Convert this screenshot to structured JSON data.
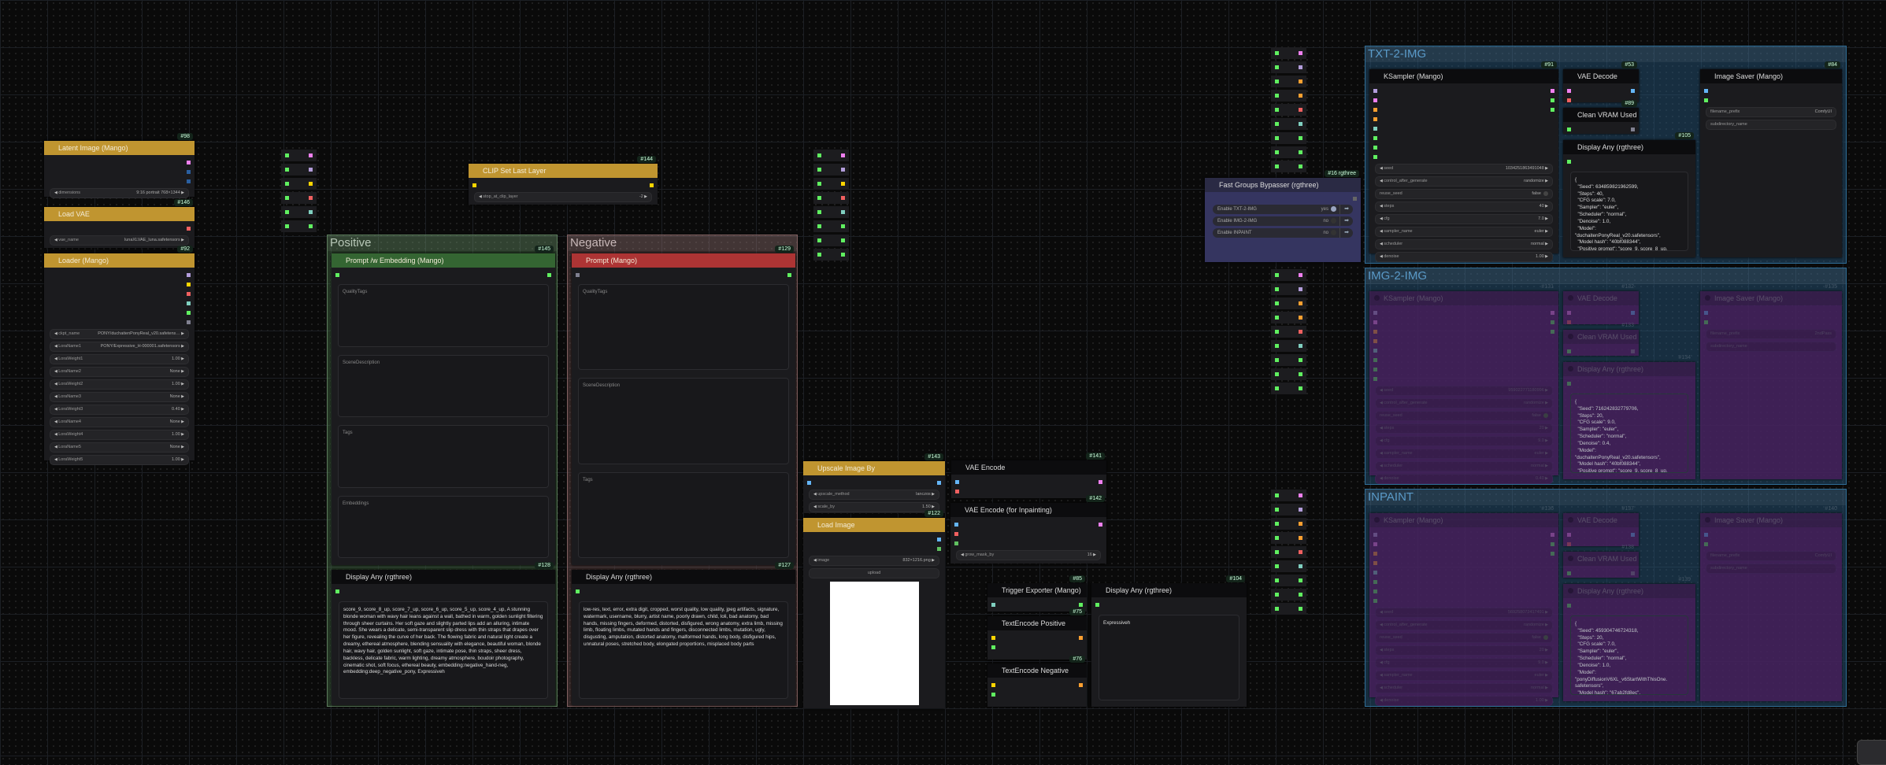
{
  "colors": {
    "header_gold": "#c09530",
    "header_green": "#346532",
    "header_red": "#ad3434",
    "header_dark": "#0c0c0e",
    "slot_pink": "#f080f0",
    "slot_purple": "#b39ddb",
    "slot_yellow": "#ffd500",
    "slot_red": "#f06060",
    "slot_teal": "#80d0c0",
    "slot_green": "#60f060",
    "slot_blue": "#64b5f6",
    "slot_darkblue": "#2a5fa0",
    "slot_orange": "#ffa030",
    "slot_gray": "#808090"
  },
  "groups": {
    "positive": {
      "title": "Positive",
      "bg": "rgba(90,140,90,0.35)",
      "border": "#5c7c5c",
      "fg": "#b8c8b8"
    },
    "negative": {
      "title": "Negative",
      "bg": "rgba(140,100,100,0.35)",
      "border": "#806060",
      "fg": "#c8b8b8"
    },
    "txt2img": {
      "title": "TXT-2-IMG",
      "bg": "rgba(40,90,130,0.45)",
      "border": "#2f6d96",
      "fg": "#5a9ac8"
    },
    "img2img": {
      "title": "IMG-2-IMG",
      "bg": "rgba(40,90,130,0.45)",
      "border": "#2f6d96",
      "fg": "#5a9ac8"
    },
    "inpaint": {
      "title": "INPAINT",
      "bg": "rgba(40,90,130,0.45)",
      "border": "#2f6d96",
      "fg": "#5a9ac8"
    }
  },
  "nodes": {
    "latent_image": {
      "id": "#98",
      "title": "Latent Image (Mango)",
      "header": "#c09530",
      "inputs": [],
      "outputs": [
        "#f080f0",
        "#2a5fa0",
        "#2a5fa0"
      ],
      "widgets": [
        {
          "label": "dimensions",
          "value": "9:16 portrait 768×1344",
          "type": "combo"
        }
      ]
    },
    "load_vae": {
      "id": "#146",
      "title": "Load VAE",
      "header": "#c09530",
      "inputs": [],
      "outputs": [
        "#f06060"
      ],
      "widgets": [
        {
          "label": "vae_name",
          "value": "lunaXLVAE_luna.safetensors",
          "type": "combo"
        }
      ]
    },
    "loader": {
      "id": "#92",
      "title": "Loader (Mango)",
      "header": "#c09530",
      "inputs": [],
      "outputs": [
        "#b39ddb",
        "#ffd500",
        "#f06060",
        "#80d0c0",
        "#60f060",
        "#808090"
      ],
      "widgets": [
        {
          "label": "ckpt_name",
          "value": "PONY/duchaitenPonyReal_v20.safetens…",
          "type": "combo"
        },
        {
          "label": "LoraName1",
          "value": "PONY/Expressive_H-000001.safetensors",
          "type": "combo"
        },
        {
          "label": "LoraWeight1",
          "value": "1.00",
          "type": "combo"
        },
        {
          "label": "LoraName2",
          "value": "None",
          "type": "combo"
        },
        {
          "label": "LoraWeight2",
          "value": "1.00",
          "type": "combo"
        },
        {
          "label": "LoraName3",
          "value": "None",
          "type": "combo"
        },
        {
          "label": "LoraWeight3",
          "value": "0.40",
          "type": "combo"
        },
        {
          "label": "LoraName4",
          "value": "None",
          "type": "combo"
        },
        {
          "label": "LoraWeight4",
          "value": "1.00",
          "type": "combo"
        },
        {
          "label": "LoraName5",
          "value": "None",
          "type": "combo"
        },
        {
          "label": "LoraWeight5",
          "value": "1.00",
          "type": "combo"
        }
      ]
    },
    "clip_last_layer": {
      "id": "#144",
      "title": "CLIP Set Last Layer",
      "header": "#c09530",
      "inputs": [
        "#ffd500"
      ],
      "outputs": [
        "#ffd500"
      ],
      "widgets": [
        {
          "label": "stop_at_clip_layer",
          "value": "-2",
          "type": "combo"
        }
      ]
    },
    "prompt_pos": {
      "id": "#145",
      "title": "Prompt /w Embedding (Mango)",
      "header": "#346532",
      "inputs": [
        "#60f060"
      ],
      "outputs": [
        "#60f060"
      ],
      "textareas": [
        "QualityTags",
        "SceneDescription",
        "Tags",
        "Embeddings"
      ]
    },
    "display_pos": {
      "id": "#128",
      "title": "Display Any (rgthree)",
      "header": "#0c0c0e",
      "inputs": [
        "#60f060"
      ],
      "outputs": [],
      "display": "score_9, score_8_up, score_7_up, score_6_up, score_5_up, score_4_up, A stunning blonde woman with wavy hair leans against a wall, bathed in warm, golden sunlight filtering through sheer curtains. Her soft gaze and slightly parted lips add an alluring, intimate mood. She wears a delicate, semi-transparent slip dress with thin straps that drapes over her figure, revealing the curve of her back. The flowing fabric and natural light create a dreamy, ethereal atmosphere, blending sensuality with elegance, beautiful woman, blonde hair, wavy hair, golden sunlight, soft gaze, intimate pose, thin straps, sheer dress, backless, delicate fabric, warm lighting, dreamy atmosphere, boudoir photography, cinematic shot, soft focus, ethereal beauty, embedding:negative_hand-neg, embedding:deep_negative_pony, Expressiveh"
    },
    "prompt_neg": {
      "id": "#129",
      "title": "Prompt (Mango)",
      "header": "#ad3434",
      "inputs": [
        "#808090"
      ],
      "outputs": [
        "#60f060"
      ],
      "textareas": [
        "QualityTags",
        "SceneDescription",
        "Tags"
      ]
    },
    "display_neg": {
      "id": "#127",
      "title": "Display Any (rgthree)",
      "header": "#0c0c0e",
      "inputs": [
        "#60f060"
      ],
      "outputs": [],
      "display": "low-res, text, error, extra digit, cropped, worst quality, low quality, jpeg artifacts, signature, watermark, username, blurry, artist name, poorly drawn, child, loli, bad anatomy, bad hands, missing fingers, deformed, distorted, disfigured, wrong anatomy, extra limb, missing limb, floating limbs, mutated hands and fingers, disconnected limbs, mutation, ugly, disgusting, amputation, distorted anatomy, malformed hands, long body, disfigured hips, unnatural poses, stretched body, elongated proportions, misplaced body parts"
    },
    "upscale": {
      "id": "#143",
      "title": "Upscale Image By",
      "header": "#c09530",
      "inputs": [
        "#64b5f6"
      ],
      "outputs": [
        "#64b5f6"
      ],
      "widgets": [
        {
          "label": "upscale_method",
          "value": "lanczos",
          "type": "combo"
        },
        {
          "label": "scale_by",
          "value": "1.50",
          "type": "combo"
        }
      ]
    },
    "load_image": {
      "id": "#122",
      "title": "Load Image",
      "header": "#c09530",
      "inputs": [],
      "outputs": [
        "#64b5f6",
        "#60c060"
      ],
      "widgets": [
        {
          "label": "image",
          "value": "832×1216.png",
          "type": "combo"
        },
        {
          "label": "upload",
          "value": "",
          "type": "button"
        }
      ],
      "preview": true
    },
    "vae_encode": {
      "id": "#141",
      "title": "VAE Encode",
      "header": "#0c0c0e",
      "inputs": [
        "#64b5f6",
        "#f06060"
      ],
      "outputs": [
        "#f080f0"
      ]
    },
    "vae_encode_inpaint": {
      "id": "#142",
      "title": "VAE Encode (for Inpainting)",
      "header": "#0c0c0e",
      "inputs": [
        "#64b5f6",
        "#f06060",
        "#60c060"
      ],
      "outputs": [
        "#f080f0"
      ],
      "widgets": [
        {
          "label": "grow_mask_by",
          "value": "16",
          "type": "combo"
        }
      ]
    },
    "trigger_exporter": {
      "id": "#85",
      "title": "Trigger Exporter (Mango)",
      "header": "#0c0c0e",
      "inputs": [
        "#80d0c0"
      ],
      "outputs": [
        "#60f060"
      ]
    },
    "textencode_pos": {
      "id": "#75",
      "title": "TextEncode Positive",
      "header": "#0c0c0e",
      "inputs": [
        "#ffd500",
        "#60f060"
      ],
      "outputs": [
        "#ffa030"
      ]
    },
    "textencode_neg": {
      "id": "#76",
      "title": "TextEncode Negative",
      "header": "#0c0c0e",
      "inputs": [
        "#ffd500",
        "#60f060"
      ],
      "outputs": [
        "#ffa030"
      ]
    },
    "display_trigger": {
      "id": "#104",
      "title": "Display Any (rgthree)",
      "header": "#0c0c0e",
      "inputs": [
        "#60f060"
      ],
      "outputs": [],
      "display": "Expressiveh"
    },
    "t2i_ksampler": {
      "id": "#91",
      "title": "KSampler (Mango)",
      "header": "#0c0c0e",
      "inputs": [
        "#b39ddb",
        "#f080f0",
        "#ffa030",
        "#ffa030",
        "#80d0c0",
        "#60f060",
        "#60f060",
        "#60f060"
      ],
      "outputs": [
        "#f080f0",
        "#60f060",
        "#60f060"
      ],
      "widgets": [
        {
          "label": "seed",
          "value": "1034251863491048",
          "type": "combo"
        },
        {
          "label": "control_after_generate",
          "value": "randomize",
          "type": "combo"
        },
        {
          "label": "reuse_seed",
          "value": "false",
          "type": "toggle"
        },
        {
          "label": "steps",
          "value": "40",
          "type": "combo"
        },
        {
          "label": "cfg",
          "value": "7.0",
          "type": "combo"
        },
        {
          "label": "sampler_name",
          "value": "euler",
          "type": "combo"
        },
        {
          "label": "scheduler",
          "value": "normal",
          "type": "combo"
        },
        {
          "label": "denoise",
          "value": "1.00",
          "type": "combo"
        }
      ]
    },
    "t2i_vae_decode": {
      "id": "#53",
      "title": "VAE Decode",
      "header": "#0c0c0e",
      "inputs": [
        "#f080f0",
        "#f06060"
      ],
      "outputs": [
        "#64b5f6"
      ]
    },
    "t2i_clean_vram": {
      "id": "#89",
      "title": "Clean VRAM Used",
      "header": "#0c0c0e",
      "inputs": [
        "#60f060"
      ],
      "outputs": [
        "#808090"
      ]
    },
    "t2i_display": {
      "id": "#105",
      "title": "Display Any (rgthree)",
      "header": "#0c0c0e",
      "inputs": [
        "#60f060"
      ],
      "outputs": [],
      "display": "{\n  \"Seed\": 634859821962599,\n  \"Steps\": 40,\n  \"CFG scale\": 7.0,\n  \"Sampler\": \"euler\",\n  \"Scheduler\": \"normal\",\n  \"Denoise\": 1.0,\n  \"Model\":\n\"duchaitenPonyReal_v20.safetensors\",\n  \"Model hash\": \"40bf088344\",\n  \"Positive prompt\": \"score_9, score_8_up,"
    },
    "t2i_image_saver": {
      "id": "#84",
      "title": "Image Saver (Mango)",
      "header": "#0c0c0e",
      "inputs": [
        "#64b5f6",
        "#60f060"
      ],
      "outputs": [],
      "widgets": [
        {
          "label": "filename_prefix",
          "value": "ComfyUI",
          "type": "text"
        },
        {
          "label": "subdirectory_name",
          "value": "",
          "type": "text"
        }
      ]
    },
    "i2i_ksampler": {
      "id": "#131",
      "title": "KSampler (Mango)",
      "header": "#0c0c0e",
      "bypassed": true,
      "inputs": [
        "#b39ddb",
        "#f080f0",
        "#ffa030",
        "#ffa030",
        "#80d0c0",
        "#60f060",
        "#60f060",
        "#60f060"
      ],
      "outputs": [
        "#f080f0",
        "#60f060",
        "#60f060"
      ],
      "widgets": [
        {
          "label": "seed",
          "value": "959022771180996",
          "type": "combo"
        },
        {
          "label": "control_after_generate",
          "value": "randomize",
          "type": "combo"
        },
        {
          "label": "reuse_seed",
          "value": "false",
          "type": "toggle"
        },
        {
          "label": "steps",
          "value": "20",
          "type": "combo"
        },
        {
          "label": "cfg",
          "value": "9.0",
          "type": "combo"
        },
        {
          "label": "sampler_name",
          "value": "euler",
          "type": "combo"
        },
        {
          "label": "scheduler",
          "value": "normal",
          "type": "combo"
        },
        {
          "label": "denoise",
          "value": "0.40",
          "type": "combo"
        }
      ]
    },
    "i2i_vae_decode": {
      "id": "#132",
      "title": "VAE Decode",
      "header": "#0c0c0e",
      "bypassed": true,
      "inputs": [
        "#f080f0",
        "#f06060"
      ],
      "outputs": [
        "#64b5f6"
      ]
    },
    "i2i_clean_vram": {
      "id": "#133",
      "title": "Clean VRAM Used",
      "header": "#0c0c0e",
      "bypassed": true,
      "inputs": [
        "#60f060"
      ],
      "outputs": [
        "#808090"
      ]
    },
    "i2i_display": {
      "id": "#134",
      "title": "Display Any (rgthree)",
      "header": "#0c0c0e",
      "bypassed": true,
      "inputs": [
        "#60f060"
      ],
      "outputs": [],
      "display": "{\n  \"Seed\": 716242832779706,\n  \"Steps\": 20,\n  \"CFG scale\": 9.0,\n  \"Sampler\": \"euler\",\n  \"Scheduler\": \"normal\",\n  \"Denoise\": 0.4,\n  \"Model\":\n\"duchaitenPonyReal_v20.safetensors\",\n  \"Model hash\": \"40bf088344\",\n  \"Positive prompt\": \"score_9, score_8_up,"
    },
    "i2i_image_saver": {
      "id": "#135",
      "title": "Image Saver (Mango)",
      "header": "#0c0c0e",
      "bypassed": true,
      "inputs": [
        "#64b5f6",
        "#60f060"
      ],
      "outputs": [],
      "widgets": [
        {
          "label": "filename_prefix",
          "value": "2ndPass",
          "type": "text"
        },
        {
          "label": "subdirectory_name",
          "value": "",
          "type": "text"
        }
      ]
    },
    "inp_ksampler": {
      "id": "#136",
      "title": "KSampler (Mango)",
      "header": "#0c0c0e",
      "bypassed": true,
      "inputs": [
        "#b39ddb",
        "#f080f0",
        "#ffa030",
        "#ffa030",
        "#80d0c0",
        "#60f060",
        "#60f060",
        "#60f060"
      ],
      "outputs": [
        "#f080f0",
        "#60f060",
        "#60f060"
      ],
      "widgets": [
        {
          "label": "seed",
          "value": "569258072417491",
          "type": "combo"
        },
        {
          "label": "control_after_generate",
          "value": "randomize",
          "type": "combo"
        },
        {
          "label": "reuse_seed",
          "value": "false",
          "type": "toggle"
        },
        {
          "label": "steps",
          "value": "20",
          "type": "combo"
        },
        {
          "label": "cfg",
          "value": "9.0",
          "type": "combo"
        },
        {
          "label": "sampler_name",
          "value": "euler",
          "type": "combo"
        },
        {
          "label": "scheduler",
          "value": "normal",
          "type": "combo"
        },
        {
          "label": "denoise",
          "value": "1.00",
          "type": "combo"
        }
      ]
    },
    "inp_vae_decode": {
      "id": "#137",
      "title": "VAE Decode",
      "header": "#0c0c0e",
      "bypassed": true,
      "inputs": [
        "#f080f0",
        "#f06060"
      ],
      "outputs": [
        "#64b5f6"
      ]
    },
    "inp_clean_vram": {
      "id": "#138",
      "title": "Clean VRAM Used",
      "header": "#0c0c0e",
      "bypassed": true,
      "inputs": [
        "#60f060"
      ],
      "outputs": [
        "#808090"
      ]
    },
    "inp_display": {
      "id": "#139",
      "title": "Display Any (rgthree)",
      "header": "#0c0c0e",
      "bypassed": true,
      "inputs": [
        "#60f060"
      ],
      "outputs": [],
      "display": "{\n  \"Seed\": 459304746724318,\n  \"Steps\": 20,\n  \"CFG scale\": 7.0,\n  \"Sampler\": \"euler\",\n  \"Scheduler\": \"normal\",\n  \"Denoise\": 1.0,\n  \"Model\":\n\"ponyDiffusionV6XL_v6StartWithThisOne.\nsafetensors\",\n  \"Model hash\": \"67ab2fd8ec\","
    },
    "inp_image_saver": {
      "id": "#140",
      "title": "Image Saver (Mango)",
      "header": "#0c0c0e",
      "bypassed": true,
      "inputs": [
        "#64b5f6",
        "#60f060"
      ],
      "outputs": [],
      "widgets": [
        {
          "label": "filename_prefix",
          "value": "ComfyUI",
          "type": "text"
        },
        {
          "label": "subdirectory_name",
          "value": "",
          "type": "text"
        }
      ]
    }
  },
  "fast_groups": {
    "id": "#16 rgthree",
    "title": "Fast Groups Bypasser (rgthree)",
    "toggles": [
      {
        "label": "Enable TXT-2-IMG",
        "value": "yes",
        "on": true
      },
      {
        "label": "Enable IMG-2-IMG",
        "value": "no",
        "on": false
      },
      {
        "label": "Enable INPAINT",
        "value": "no",
        "on": false
      }
    ]
  },
  "reroutes": {
    "col_a": [
      "#f080f0",
      "#b39ddb",
      "#ffd500",
      "#f06060",
      "#80d0c0",
      "#60f060"
    ],
    "col_b": [
      "#f080f0",
      "#b39ddb",
      "#ffd500",
      "#f06060",
      "#80d0c0",
      "#60f060",
      "#60f060",
      "#60f060"
    ],
    "col_c_top": [
      "#f080f0",
      "#b39ddb",
      "#ffa030",
      "#ffa030",
      "#f06060",
      "#80d0c0",
      "#60f060",
      "#60f060",
      "#60f060"
    ],
    "col_c_mid": [
      "#f080f0",
      "#b39ddb",
      "#ffa030",
      "#ffa030",
      "#f06060",
      "#80d0c0",
      "#60f060",
      "#60f060",
      "#60f060"
    ],
    "col_c_bot": [
      "#f080f0",
      "#b39ddb",
      "#ffa030",
      "#ffa030",
      "#f06060",
      "#80d0c0",
      "#60f060",
      "#60f060",
      "#60f060"
    ]
  }
}
